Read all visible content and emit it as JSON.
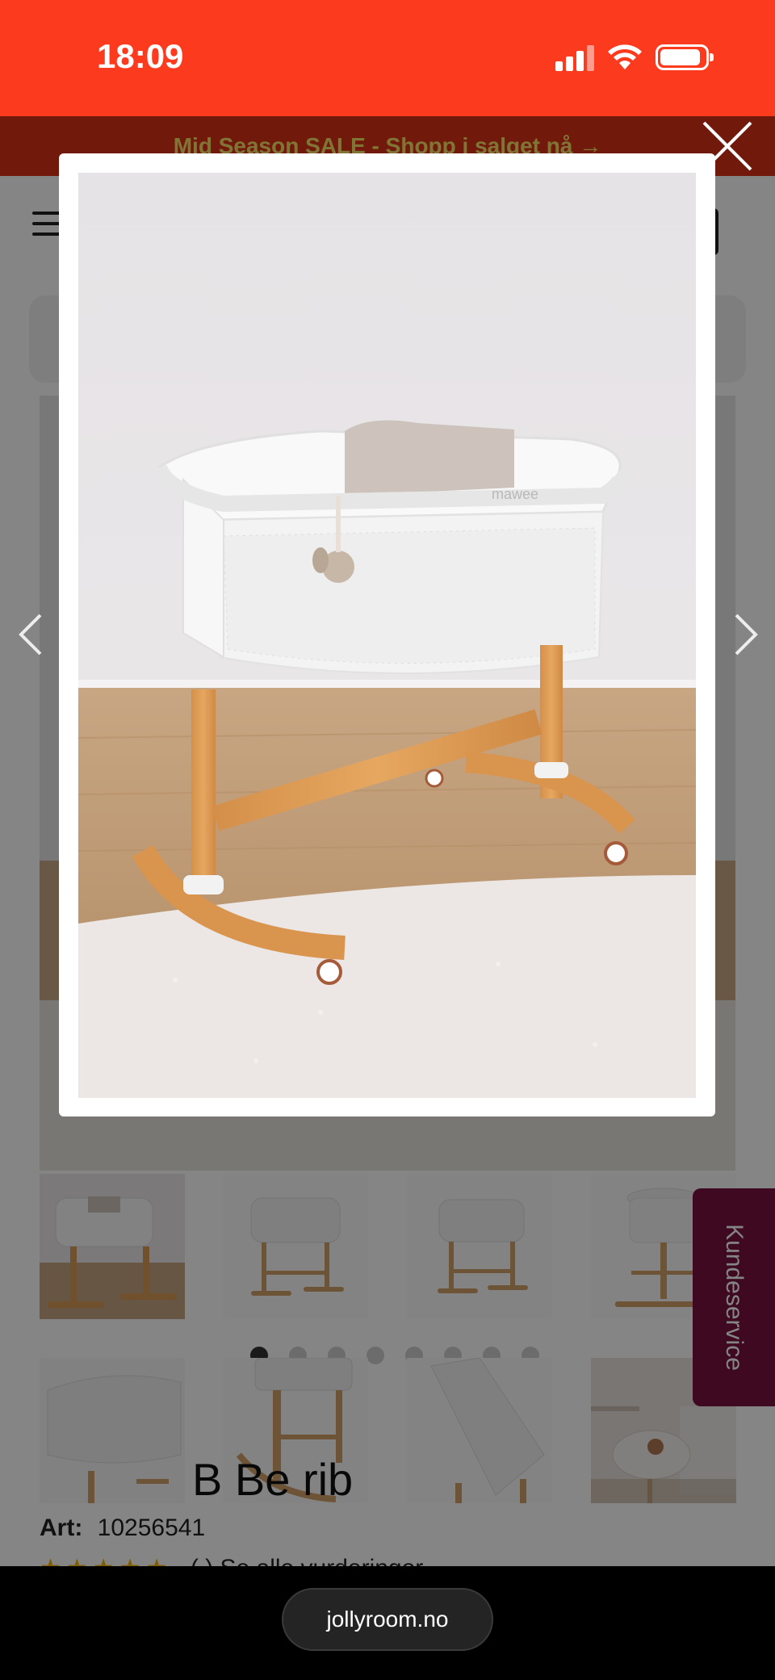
{
  "status_bar": {
    "time": "18:09"
  },
  "promo_banner": {
    "text": "Mid Season SALE - Shopp i salget nå →"
  },
  "lightbox": {
    "brand_text": "mawee"
  },
  "product": {
    "title_visible": "B          Be          rib",
    "art_label": "Art:",
    "art_number": "10256541",
    "rating_text": "(  )  Se alle vurderinger",
    "stars": "★★★★★"
  },
  "kundeservice": {
    "label": "Kundeservice"
  },
  "carousel": {
    "dot_count": 8,
    "active_index": 0
  },
  "browser": {
    "url": "jollyroom.no"
  },
  "colors": {
    "status_bar": "#fb3a1e",
    "promo_banner": "#d93316",
    "promo_text": "#f7e067",
    "kundeservice": "#7a1242"
  },
  "icons": [
    "close-icon",
    "chevron-left-icon",
    "chevron-right-icon",
    "hamburger-menu-icon",
    "cart-icon",
    "signal-icon",
    "wifi-icon",
    "battery-icon"
  ]
}
